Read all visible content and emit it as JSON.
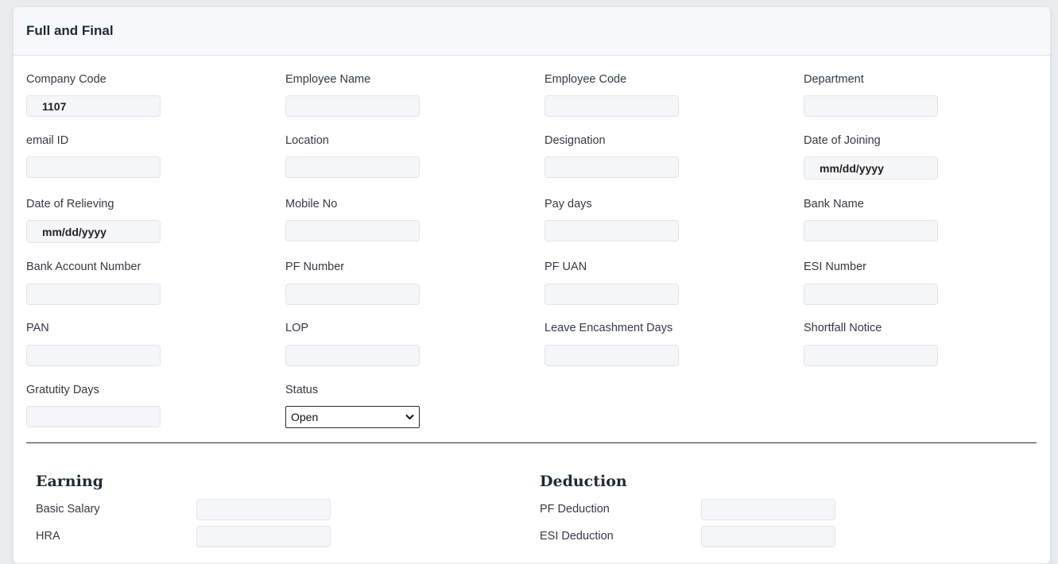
{
  "card": {
    "title": "Full and Final"
  },
  "fields": {
    "company_code": {
      "label": "Company Code",
      "value": "1107"
    },
    "employee_name": {
      "label": "Employee Name",
      "value": ""
    },
    "employee_code": {
      "label": "Employee Code",
      "value": ""
    },
    "department": {
      "label": "Department",
      "value": ""
    },
    "email_id": {
      "label": "email ID",
      "value": ""
    },
    "location": {
      "label": "Location",
      "value": ""
    },
    "designation": {
      "label": "Designation",
      "value": ""
    },
    "date_of_joining": {
      "label": "Date of Joining",
      "value": "mm/dd/yyyy"
    },
    "date_of_relieving": {
      "label": "Date of Relieving",
      "value": "mm/dd/yyyy"
    },
    "mobile_no": {
      "label": "Mobile No",
      "value": ""
    },
    "pay_days": {
      "label": "Pay days",
      "value": ""
    },
    "bank_name": {
      "label": "Bank Name",
      "value": ""
    },
    "bank_account_number": {
      "label": "Bank Account Number",
      "value": ""
    },
    "pf_number": {
      "label": "PF Number",
      "value": ""
    },
    "pf_uan": {
      "label": "PF UAN",
      "value": ""
    },
    "esi_number": {
      "label": "ESI Number",
      "value": ""
    },
    "pan": {
      "label": "PAN",
      "value": ""
    },
    "lop": {
      "label": "LOP",
      "value": ""
    },
    "leave_encashment_days": {
      "label": "Leave Encashment Days",
      "value": ""
    },
    "shortfall_notice": {
      "label": "Shortfall Notice",
      "value": ""
    },
    "gratuity_days": {
      "label": "Gratutity Days",
      "value": ""
    },
    "status": {
      "label": "Status",
      "selected": "Open"
    }
  },
  "earning": {
    "title": "Earning",
    "basic_salary": {
      "label": "Basic Salary",
      "value": ""
    },
    "hra": {
      "label": "HRA",
      "value": ""
    }
  },
  "deduction": {
    "title": "Deduction",
    "pf_deduction": {
      "label": "PF Deduction",
      "value": ""
    },
    "esi_deduction": {
      "label": "ESI Deduction",
      "value": ""
    }
  }
}
